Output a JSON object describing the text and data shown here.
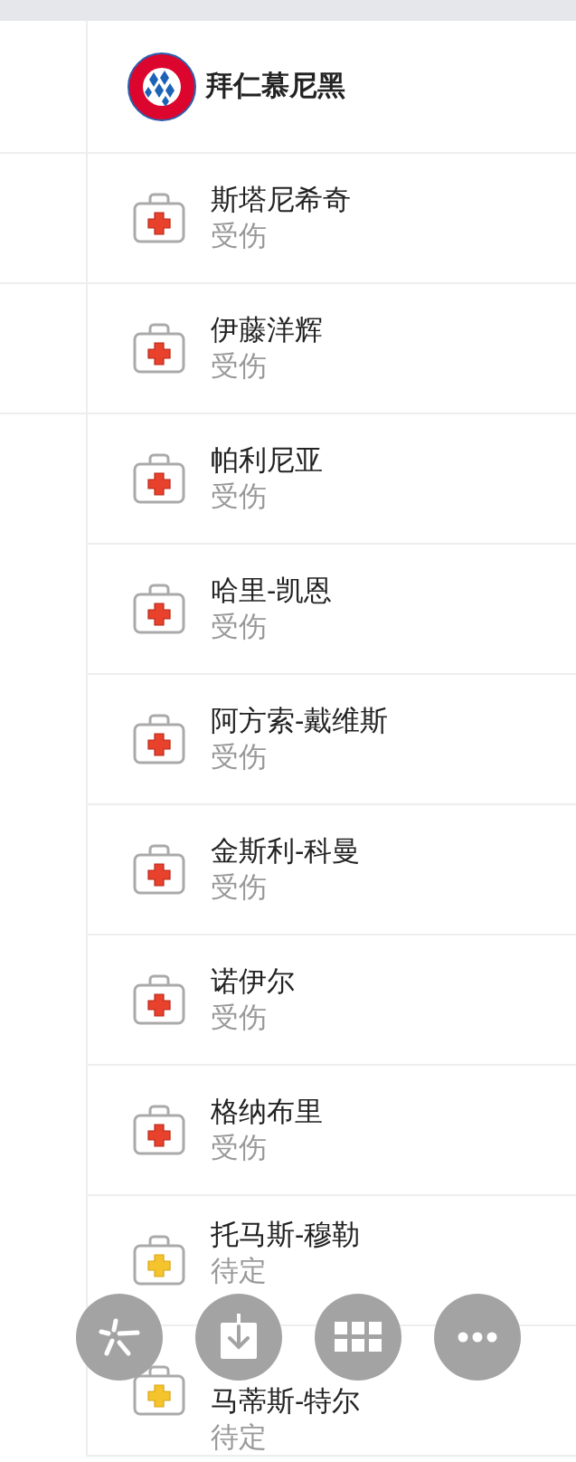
{
  "team": {
    "name": "拜仁慕尼黑"
  },
  "players": [
    {
      "name": "斯塔尼希奇",
      "status": "受伤",
      "kind": "injured"
    },
    {
      "name": "伊藤洋辉",
      "status": "受伤",
      "kind": "injured"
    },
    {
      "name": "帕利尼亚",
      "status": "受伤",
      "kind": "injured"
    },
    {
      "name": "哈里-凯恩",
      "status": "受伤",
      "kind": "injured"
    },
    {
      "name": "阿方索-戴维斯",
      "status": "受伤",
      "kind": "injured"
    },
    {
      "name": "金斯利-科曼",
      "status": "受伤",
      "kind": "injured"
    },
    {
      "name": "诺伊尔",
      "status": "受伤",
      "kind": "injured"
    },
    {
      "name": "格纳布里",
      "status": "受伤",
      "kind": "injured"
    },
    {
      "name": "托马斯-穆勒",
      "status": "待定",
      "kind": "pending"
    },
    {
      "name": "马蒂斯-特尔",
      "status": "待定",
      "kind": "pending"
    }
  ]
}
